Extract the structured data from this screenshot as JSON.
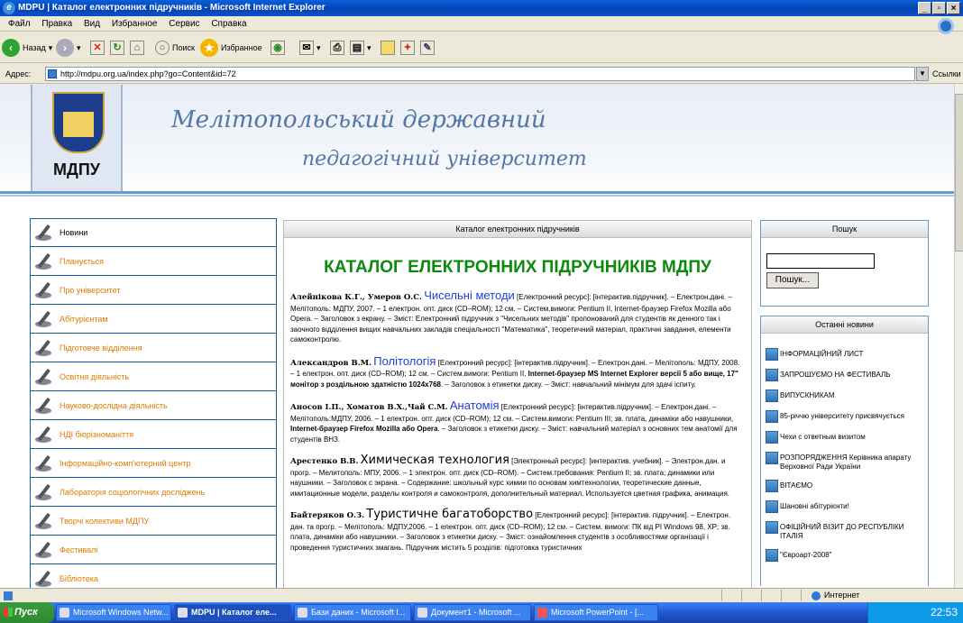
{
  "window": {
    "title": "MDPU | Каталог електронних підручників - Microsoft Internet Explorer",
    "controls": [
      "_",
      "8",
      "×"
    ]
  },
  "menu": [
    "Файл",
    "Правка",
    "Вид",
    "Избранное",
    "Сервис",
    "Справка"
  ],
  "toolbar": {
    "back": "Назад",
    "search": "Поиск",
    "favorites": "Избранное"
  },
  "address": {
    "label": "Адрес:",
    "url": "http://mdpu.org.ua/index.php?go=Content&id=72",
    "links": "Ссылки"
  },
  "header": {
    "logo_text": "МДПУ",
    "line1": "Мелітопольський державний",
    "line2": "педагогічний університет"
  },
  "nav": [
    "Новини",
    "Планується",
    "Про університет",
    "Абітурієнтам",
    "Підготовче відділення",
    "Освітня діяльність",
    "Науково-дослідна діяльність",
    "НДІ біорізноманіття",
    "Інформаційно-комп'ютерний центр",
    "Лабораторія соціологічних досліджень",
    "Творчі колективи МДПУ",
    "Фестивалі",
    "Бібліотека"
  ],
  "center": {
    "header": "Каталог електронних підручників",
    "title": "КАТАЛОГ ЕЛЕКТРОННИХ ПІДРУЧНИКІВ МДПУ",
    "entries": [
      {
        "author": "Алейнікова К.Г., Умеров О.С.",
        "book": "Чисельні методи",
        "pre": "",
        "mid": "",
        "text": "[Електронний ресурс]: [інтерактив.підручник]. – Електрон.дані. – Мелітополь: МДПУ, 2007. – 1 електрон. опт. диск (CD–ROM); 12 см. – Систем.вимоги: Pentium II, Internet-браузер Firefox Mozilla або Opera. – Заголовок з екрану. – Зміст: Електронний підручник з \"Чисельних методів\" пропонований для студентів як денного так і заочного відділення вищих навчальних закладів спеціальності \"Математика\", теоретичний матеріал, практичні завдання, елементи самоконтролю."
      },
      {
        "author": "Александров В.М.",
        "book": "Політологія",
        "pre": "[Електронний ресурс]: [інтерактив.підручник]. – Електрон.дані. – Мелітополь: МДПУ, 2008. – 1 електрон. опт. диск (CD–ROM); 12 см. – Систем.вимоги: Pentium II,",
        "mid": "Internet-браузер MS Internet Explorer версії 5 або вище, 17\" монітор з роздільною здатністю 1024x768",
        "text": ". – Заголовок з етикетки диску. – Зміст: навчальний мінімум для здачі іспиту."
      },
      {
        "author": "Аносов І.П., Хоматов В.Х.,Чай С.М.",
        "book": "Анатомія",
        "pre": "[Електронний ресурс]: [інтерактив.підручник]. – Електрон.дані. – Мелітополь:МДПУ, 2006. – 1 електрон. опт. диск (CD–ROM); 12 см. – Систем.вимоги: Pentium III; зв. плата, динаміки або навушники,",
        "mid": "Internet-браузер Firefox Mozilla або Opera",
        "text": ". – Заголовок з етикетки диску. – Зміст: навчальний матеріал з основних тем анатомії для студентів ВНЗ."
      },
      {
        "author": "Арестенко В.В.",
        "book": "Химическая технология",
        "pre": "",
        "mid": "",
        "text": "[Электронный ресурс]: [интерактив. учебник]. – Электрон.дан. и прогр. – Мелитополь: МПУ, 2006. – 1 электрон. опт. диск (CD–ROM). – Систем.требования: Pentium II; зв. плата; динамики или наушники. – Заголовок с экрана. – Содержание: школьный курс химии по основам химтехнологии, теоретические данные, имитационные модели, разделы контроля и самоконтроля, дополнительный материал. Используется цветная графика, анимация."
      },
      {
        "author": "Байтеряков О.З.",
        "book": "Туристичне багатоборство",
        "pre": "",
        "mid": "",
        "text": "[Електронний ресурс]: [інтерактив. підручник]. – Електрон. дан. та прогр. – Мелітополь: МДПУ,2006. – 1 електрон. опт. диск (CD–ROM); 12 см. – Систем. вимоги: ПК від PI Windows 98, XP; зв. плата, динаміки або навушники. – Заголовок з етикетки диску. – Зміст: ознайомлення студентів з особливостями організації і проведення туристичних змагань. Підручник містить 5 розділів: підготовка туристичних"
      }
    ]
  },
  "search": {
    "header": "Пошук",
    "button": "Пошук..."
  },
  "news": {
    "header": "Останні новини",
    "items": [
      "ІНФОРМАЦІЙНИЙ ЛИСТ",
      "ЗАПРОШУЄМО НА ФЕСТИВАЛЬ",
      "ВИПУСКНИКАМ",
      "85-річчю університету присвячується",
      "Чехи с ответным визитом",
      "РОЗПОРЯДЖЕННЯ Керівника апарату Верховної Ради України",
      "ВІТАЄМО",
      "Шановні абітурієнти!",
      "ОФІЦІЙНИЙ ВІЗИТ ДО РЕСПУБЛІКИ ІТАЛІЯ",
      "\"Євроарт-2008\""
    ]
  },
  "status": {
    "zone": "Интернет"
  },
  "taskbar": {
    "start": "Пуск",
    "tasks": [
      "Microsoft Windows Netw...",
      "MDPU | Каталог еле...",
      "Бази даних - Microsoft I...",
      "Документ1 - Microsoft ...",
      "Microsoft PowerPoint - [..."
    ],
    "clock": "22:53"
  },
  "colors": {
    "titlebar": "#0443b3",
    "title_green": "#0c8a0c",
    "book_blue": "#1a3fd6",
    "nav_orange": "#e07a00",
    "nav_border": "#1f5aa7"
  }
}
